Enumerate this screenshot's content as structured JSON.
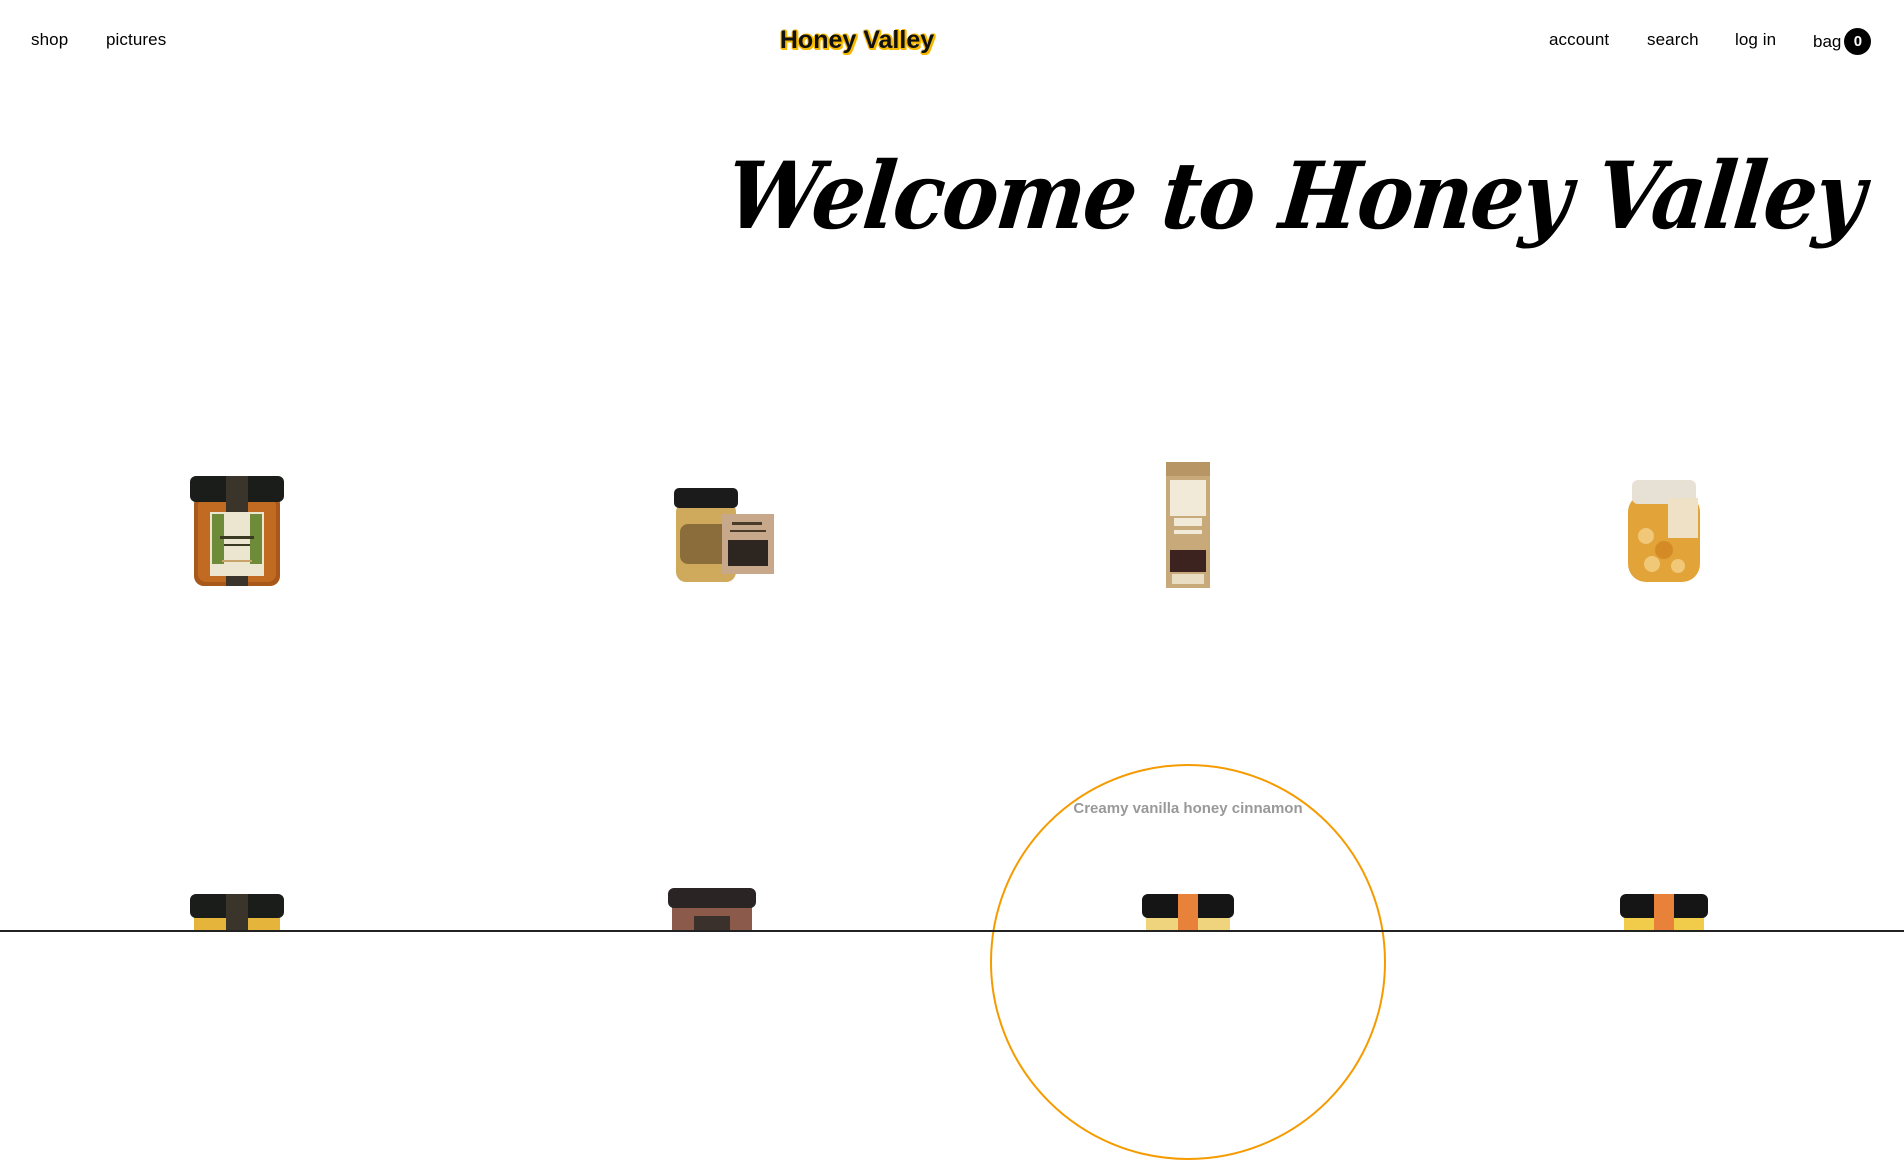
{
  "nav": {
    "brand": "Honey Valley",
    "left": [
      {
        "label": "shop"
      },
      {
        "label": "pictures"
      }
    ],
    "right": [
      {
        "label": "account"
      },
      {
        "label": "search"
      },
      {
        "label": "log in"
      }
    ],
    "bag": {
      "label": "bag",
      "count": "0"
    }
  },
  "hero": {
    "title": "Welcome to Honey Valley"
  },
  "hover_product": {
    "title": "Creamy vanilla honey cinnamon"
  },
  "colors": {
    "brand_glow": "#f5b800",
    "hover_ring": "#f59b00",
    "hover_text": "#999999"
  }
}
